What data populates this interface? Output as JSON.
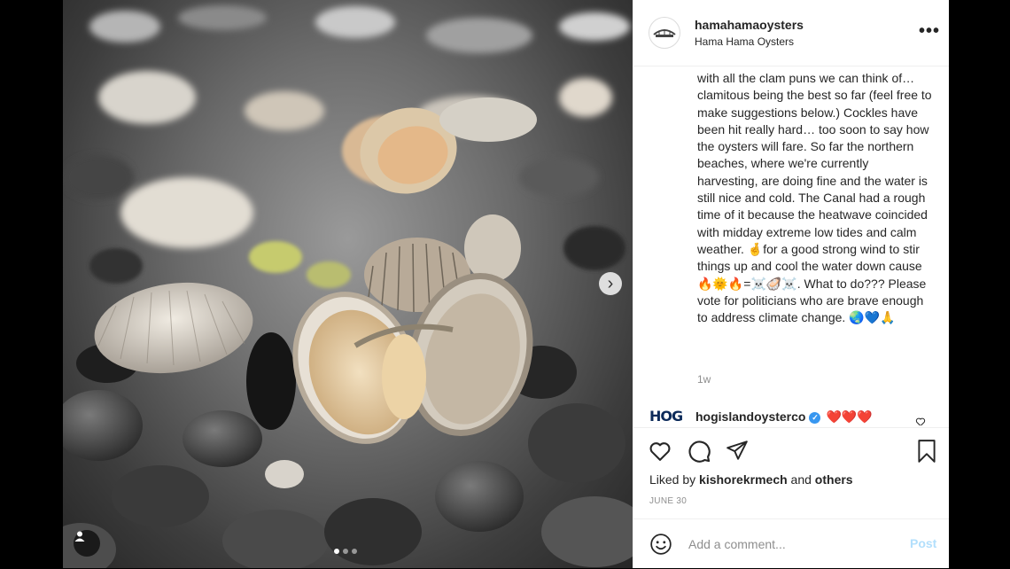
{
  "post": {
    "username": "hamahamaoysters",
    "location": "Hama Hama Oysters",
    "more_icon": "more-options-icon",
    "caption": "with all the clam puns we can think of… clamitous being the best so far (feel free to make suggestions below.) Cockles have been hit really hard… too soon to say how the oysters will fare. So far the northern beaches, where we're currently harvesting, are doing fine and the water is still nice and cold. The Canal had a rough time of it because the heatwave coincided with midday extreme low tides and calm weather. 🤞for a good strong wind to stir things up and cool the water down cause🔥🌞🔥=☠️🦪☠️. What to do??? Please vote for politicians who are brave enough to address climate change. 🌏💙🙏",
    "timestamp": "1w"
  },
  "comment": {
    "username": "hogislandoysterco",
    "text": "❤️❤️❤️",
    "avatar_text": "HOG"
  },
  "actions": {
    "liked_by_prefix": "Liked by",
    "liked_by_user": "kishorekrmech",
    "liked_by_and": "and",
    "liked_by_others": "others",
    "date": "JUNE 30"
  },
  "add_comment": {
    "placeholder": "Add a comment...",
    "post_label": "Post"
  },
  "media": {
    "next_icon": "chevron-right-icon",
    "next_glyph": "›",
    "carousel_count": 3,
    "carousel_active": 0
  }
}
